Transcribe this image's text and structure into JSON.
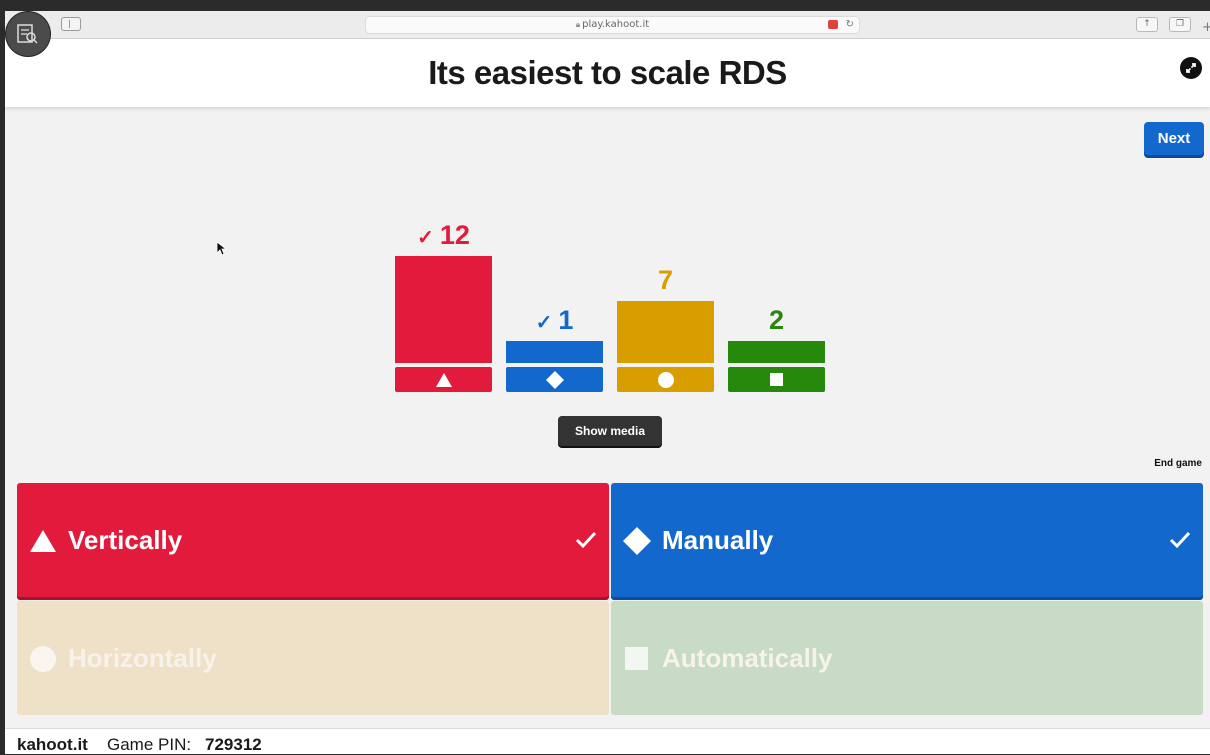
{
  "browser": {
    "url": "play.kahoot.it"
  },
  "question": {
    "title": "Its easiest to scale RDS"
  },
  "controls": {
    "next_label": "Next",
    "show_media_label": "Show media",
    "end_game_label": "End game"
  },
  "chart_data": {
    "type": "bar",
    "categories": [
      "triangle",
      "diamond",
      "circle",
      "square"
    ],
    "values": [
      12,
      1,
      7,
      2
    ],
    "correct": [
      true,
      true,
      false,
      false
    ],
    "colors": [
      "#e21b3c",
      "#1368ce",
      "#d89e00",
      "#26890c"
    ]
  },
  "answers": [
    {
      "text": "Vertically",
      "shape": "triangle",
      "correct": true,
      "color": "#e21b3c"
    },
    {
      "text": "Manually",
      "shape": "diamond",
      "correct": true,
      "color": "#1368ce"
    },
    {
      "text": "Horizontally",
      "shape": "circle",
      "correct": false,
      "color": "#efe0c8"
    },
    {
      "text": "Automatically",
      "shape": "square",
      "correct": false,
      "color": "#c8dbc4"
    }
  ],
  "footer": {
    "brand": "kahoot.it",
    "pin_label": "Game PIN:",
    "pin": "729312"
  }
}
